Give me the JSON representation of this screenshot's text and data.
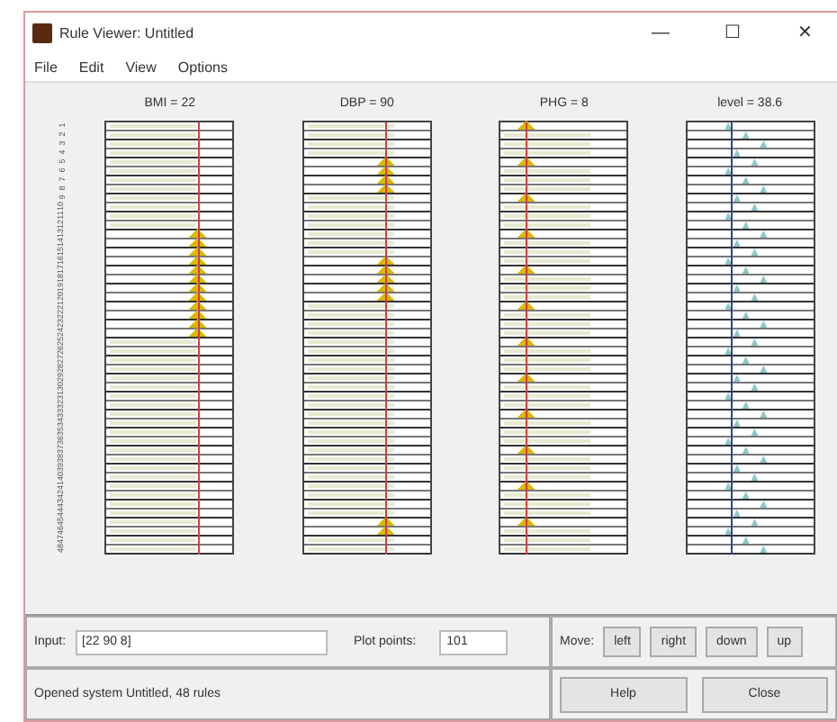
{
  "window": {
    "title": "Rule Viewer: Untitled",
    "controls": [
      "—",
      "☐",
      "✕"
    ]
  },
  "menu": [
    "File",
    "Edit",
    "View",
    "Options"
  ],
  "variables": [
    {
      "label": "BMI = 22",
      "kind": "input",
      "level": 0.72
    },
    {
      "label": "DBP = 90",
      "kind": "input",
      "level": 0.65
    },
    {
      "label": "PHG = 8",
      "kind": "input",
      "level": 0.2
    },
    {
      "label": "level = 38.6",
      "kind": "output",
      "level": 0.35
    }
  ],
  "rules": [
    {
      "number": "1",
      "fired": [
        false,
        false,
        true
      ]
    },
    {
      "number": "2",
      "fired": [
        false,
        false,
        false
      ]
    },
    {
      "number": "3",
      "fired": [
        false,
        false,
        false
      ]
    },
    {
      "number": "4",
      "fired": [
        false,
        false,
        false
      ]
    },
    {
      "number": "5",
      "fired": [
        false,
        true,
        true
      ]
    },
    {
      "number": "6",
      "fired": [
        false,
        true,
        false
      ]
    },
    {
      "number": "7",
      "fired": [
        false,
        true,
        false
      ]
    },
    {
      "number": "8",
      "fired": [
        false,
        true,
        false
      ]
    },
    {
      "number": "9",
      "fired": [
        false,
        false,
        true
      ]
    },
    {
      "number": "10",
      "fired": [
        false,
        false,
        false
      ]
    },
    {
      "number": "11",
      "fired": [
        false,
        false,
        false
      ]
    },
    {
      "number": "12",
      "fired": [
        false,
        false,
        false
      ]
    },
    {
      "number": "13",
      "fired": [
        true,
        false,
        true
      ]
    },
    {
      "number": "14",
      "fired": [
        true,
        false,
        false
      ]
    },
    {
      "number": "15",
      "fired": [
        true,
        false,
        false
      ]
    },
    {
      "number": "16",
      "fired": [
        true,
        true,
        false
      ]
    },
    {
      "number": "17",
      "fired": [
        true,
        true,
        true
      ]
    },
    {
      "number": "18",
      "fired": [
        true,
        true,
        false
      ]
    },
    {
      "number": "19",
      "fired": [
        true,
        true,
        false
      ]
    },
    {
      "number": "20",
      "fired": [
        true,
        true,
        false
      ]
    },
    {
      "number": "21",
      "fired": [
        true,
        false,
        true
      ]
    },
    {
      "number": "22",
      "fired": [
        true,
        false,
        false
      ]
    },
    {
      "number": "23",
      "fired": [
        true,
        false,
        false
      ]
    },
    {
      "number": "24",
      "fired": [
        true,
        false,
        false
      ]
    },
    {
      "number": "25",
      "fired": [
        false,
        false,
        true
      ]
    },
    {
      "number": "26",
      "fired": [
        false,
        false,
        false
      ]
    },
    {
      "number": "27",
      "fired": [
        false,
        false,
        false
      ]
    },
    {
      "number": "28",
      "fired": [
        false,
        false,
        false
      ]
    },
    {
      "number": "29",
      "fired": [
        false,
        false,
        true
      ]
    },
    {
      "number": "30",
      "fired": [
        false,
        false,
        false
      ]
    },
    {
      "number": "31",
      "fired": [
        false,
        false,
        false
      ]
    },
    {
      "number": "32",
      "fired": [
        false,
        false,
        false
      ]
    },
    {
      "number": "33",
      "fired": [
        false,
        false,
        true
      ]
    },
    {
      "number": "34",
      "fired": [
        false,
        false,
        false
      ]
    },
    {
      "number": "35",
      "fired": [
        false,
        false,
        false
      ]
    },
    {
      "number": "36",
      "fired": [
        false,
        false,
        false
      ]
    },
    {
      "number": "37",
      "fired": [
        false,
        false,
        true
      ]
    },
    {
      "number": "38",
      "fired": [
        false,
        false,
        false
      ]
    },
    {
      "number": "39",
      "fired": [
        false,
        false,
        false
      ]
    },
    {
      "number": "40",
      "fired": [
        false,
        false,
        false
      ]
    },
    {
      "number": "41",
      "fired": [
        false,
        false,
        true
      ]
    },
    {
      "number": "42",
      "fired": [
        false,
        false,
        false
      ]
    },
    {
      "number": "43",
      "fired": [
        false,
        false,
        false
      ]
    },
    {
      "number": "44",
      "fired": [
        false,
        false,
        false
      ]
    },
    {
      "number": "45",
      "fired": [
        false,
        true,
        true
      ]
    },
    {
      "number": "46",
      "fired": [
        false,
        true,
        false
      ]
    },
    {
      "number": "47",
      "fired": [
        false,
        false,
        false
      ]
    },
    {
      "number": "48",
      "fired": [
        false,
        false,
        false
      ]
    }
  ],
  "input": {
    "label": "Input:",
    "value": "[22 90 8]"
  },
  "plot_points": {
    "label": "Plot points:",
    "value": "101"
  },
  "move": {
    "label": "Move:",
    "buttons": [
      "left",
      "right",
      "down",
      "up"
    ]
  },
  "status": "Opened system Untitled, 48 rules",
  "buttons": [
    "Help",
    "Close"
  ]
}
